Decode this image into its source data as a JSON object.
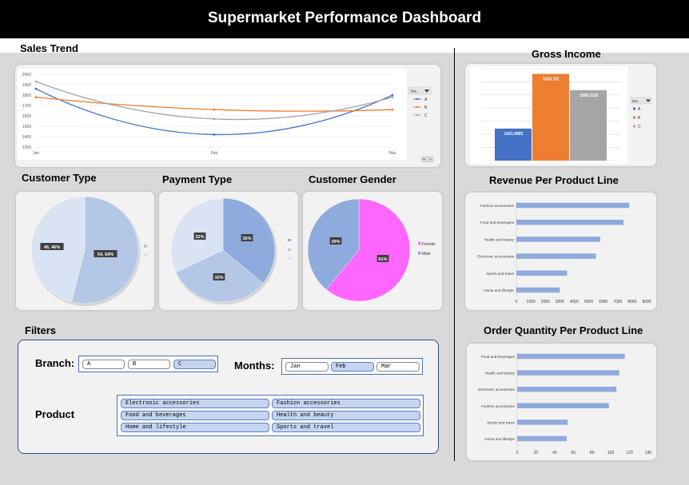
{
  "header": {
    "title": "Supermarket Performance Dashboard"
  },
  "titles": {
    "sales_trend": "Sales Trend",
    "gross_income": "Gross Income",
    "customer_type": "Customer Type",
    "payment_type": "Payment Type",
    "customer_gender": "Customer Gender",
    "revenue_per_product_line": "Revenue Per Product Line",
    "order_quantity_per_product_line": "Order Quantity Per Product Line",
    "filters": "Filters"
  },
  "chart_data": [
    {
      "id": "sales-trend",
      "type": "line",
      "categories": [
        "Jan",
        "Feb",
        "Mar"
      ],
      "series": [
        {
          "name": "A",
          "values": [
            1860,
            1420,
            1800
          ],
          "color": "#4472c4"
        },
        {
          "name": "B",
          "values": [
            1780,
            1660,
            1660
          ],
          "color": "#ed7d31"
        },
        {
          "name": "C",
          "values": [
            1930,
            1570,
            1780
          ],
          "color": "#a5a5a5"
        }
      ],
      "ylim": [
        1300,
        2000
      ],
      "yticks": [
        "1300",
        "1400",
        "1500",
        "1600",
        "1700",
        "1800",
        "1900",
        "2000"
      ],
      "legend_header": "Bra...",
      "legend": "right",
      "grid": true
    },
    {
      "id": "gross-income",
      "type": "bar",
      "categories": [
        "A",
        "B",
        "C"
      ],
      "values": [
        1421.9905,
        1630.251,
        1568.3325
      ],
      "value_labels": [
        "1421.9905",
        "1630.251",
        "1568.3325"
      ],
      "colors": [
        "#4472c4",
        "#ed7d31",
        "#a5a5a5"
      ],
      "legend_header": "Bra...",
      "legend": "right",
      "grid": true
    },
    {
      "id": "customer-type",
      "type": "pie",
      "values": [
        54,
        46
      ],
      "labels": [
        "54, 54%",
        "46, 46%"
      ],
      "colors": [
        "#b4c7e7",
        "#dae3f3"
      ]
    },
    {
      "id": "payment-type",
      "type": "pie",
      "values": [
        36,
        32,
        32
      ],
      "labels": [
        "36%",
        "32%",
        "32%"
      ],
      "colors": [
        "#8faadc",
        "#b4c7e7",
        "#dae3f3"
      ]
    },
    {
      "id": "customer-gender",
      "type": "pie",
      "values": [
        61,
        39
      ],
      "labels": [
        "61%",
        "39%"
      ],
      "colors": [
        "#ff66ff",
        "#8faadc"
      ],
      "legend": [
        {
          "name": "Female",
          "color": "#ff66ff"
        },
        {
          "name": "Male",
          "color": "#8faadc"
        }
      ]
    },
    {
      "id": "revenue-per-product-line",
      "type": "bar",
      "orientation": "horizontal",
      "categories": [
        "Fashion accessories",
        "Food and beverages",
        "Health and beauty",
        "Electronic accessories",
        "Sports and travel",
        "Home and lifestyle"
      ],
      "values": [
        7800,
        7400,
        5800,
        5500,
        3500,
        3000
      ],
      "xlim": [
        0,
        9000
      ],
      "xticks": [
        "0",
        "1000",
        "2000",
        "3000",
        "4000",
        "5000",
        "6000",
        "7000",
        "8000",
        "9000"
      ],
      "color": "#8faadc"
    },
    {
      "id": "order-quantity-per-product-line",
      "type": "bar",
      "orientation": "horizontal",
      "categories": [
        "Food and beverages",
        "Health and beauty",
        "Electronic accessories",
        "Fashion accessories",
        "Sports and travel",
        "Home and lifestyle"
      ],
      "values": [
        115,
        109,
        106,
        98,
        54,
        53
      ],
      "xlim": [
        0,
        140
      ],
      "xticks": [
        "0",
        "20",
        "40",
        "60",
        "80",
        "100",
        "120",
        "140"
      ],
      "color": "#8faadc"
    }
  ],
  "filters": {
    "branch_label": "Branch:",
    "branches": [
      {
        "label": "A",
        "selected": false
      },
      {
        "label": "B",
        "selected": false
      },
      {
        "label": "C",
        "selected": true
      }
    ],
    "months_label": "Months:",
    "months": [
      {
        "label": "Jan",
        "selected": false
      },
      {
        "label": "Feb",
        "selected": true
      },
      {
        "label": "Mar",
        "selected": false
      }
    ],
    "product_label": "Product",
    "products": [
      {
        "label": "Electronic accessories",
        "selected": true
      },
      {
        "label": "Fashion accessories",
        "selected": true
      },
      {
        "label": "Food and beverages",
        "selected": true
      },
      {
        "label": "Health and beauty",
        "selected": true
      },
      {
        "label": "Home and lifestyle",
        "selected": true
      },
      {
        "label": "Sports and travel",
        "selected": true
      }
    ]
  }
}
